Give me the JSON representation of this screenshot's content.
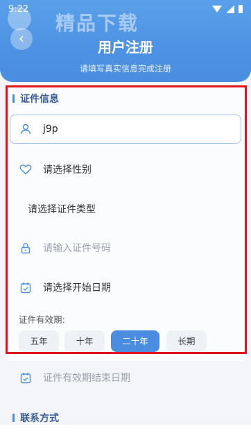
{
  "status": {
    "time": "9:22"
  },
  "header": {
    "watermark": "精品下载",
    "back_icon": "chevron-left-icon",
    "title": "用户注册",
    "subtitle": "请填写真实信息完成注册"
  },
  "section_id": {
    "title": "证件信息"
  },
  "form": {
    "name_value": "j9p",
    "gender_placeholder": "请选择性别",
    "id_type_placeholder": "请选择证件类型",
    "id_number_placeholder": "请输入证件号码",
    "start_date_placeholder": "请选择开始日期",
    "validity_label": "证件有效期:",
    "validity_options": [
      "五年",
      "十年",
      "二十年",
      "长期"
    ],
    "validity_selected": "二十年",
    "end_date_placeholder": "证件有效期结束日期"
  },
  "section_contact": {
    "title": "联系方式"
  },
  "colors": {
    "accent": "#4a8de0",
    "highlight_box": "#e0141c"
  }
}
